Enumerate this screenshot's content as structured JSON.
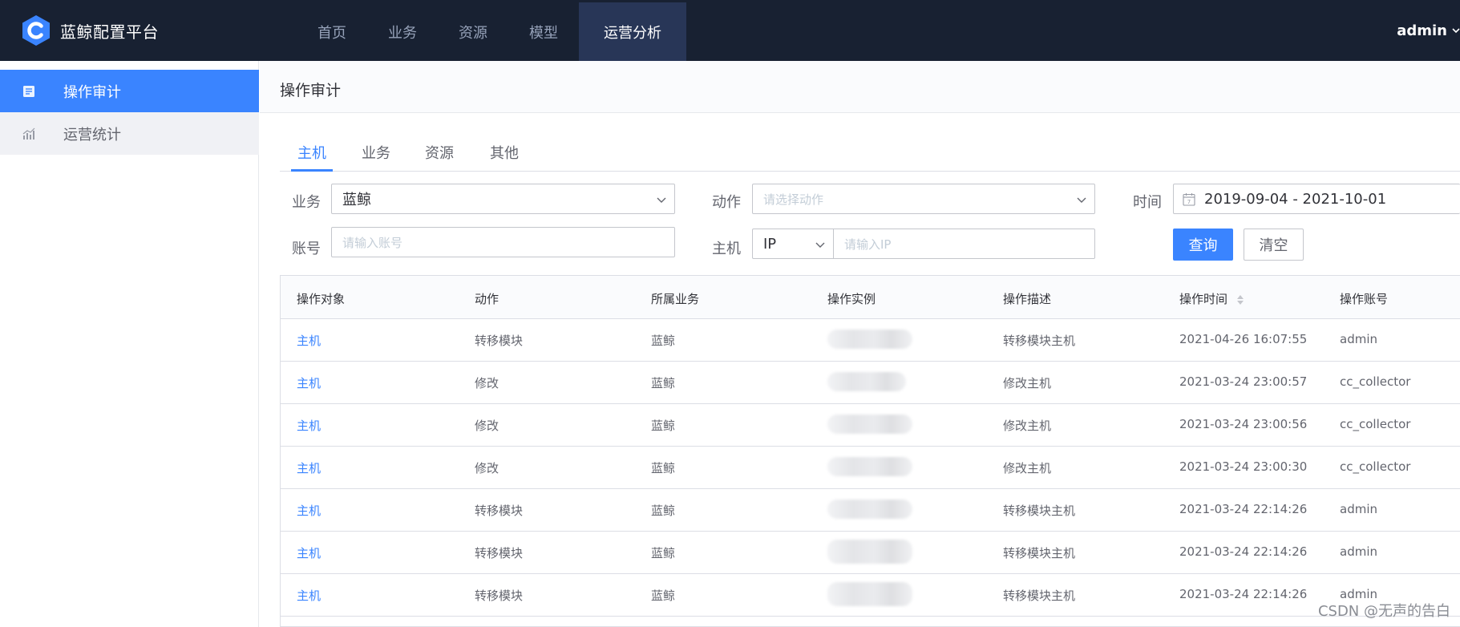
{
  "app": {
    "name": "蓝鲸配置平台"
  },
  "topnav": {
    "items": [
      {
        "label": "首页"
      },
      {
        "label": "业务"
      },
      {
        "label": "资源"
      },
      {
        "label": "模型"
      },
      {
        "label": "运营分析"
      }
    ],
    "active": "运营分析"
  },
  "user": {
    "name": "admin"
  },
  "sidebar": {
    "items": [
      {
        "label": "操作审计",
        "icon": "audit-icon",
        "active": true
      },
      {
        "label": "运营统计",
        "icon": "chart-icon",
        "active": false
      }
    ]
  },
  "page": {
    "title": "操作审计"
  },
  "tabs": [
    {
      "label": "主机"
    },
    {
      "label": "业务"
    },
    {
      "label": "资源"
    },
    {
      "label": "其他"
    }
  ],
  "filters": {
    "business_label": "业务",
    "business_value": "蓝鲸",
    "action_label": "动作",
    "action_placeholder": "请选择动作",
    "time_label": "时间",
    "time_value": "2019-09-04 - 2021-10-01",
    "account_label": "账号",
    "account_placeholder": "请输入账号",
    "host_label": "主机",
    "host_type": "IP",
    "host_placeholder": "请输入IP",
    "query_button": "查询",
    "clear_button": "清空"
  },
  "table": {
    "columns": [
      "操作对象",
      "动作",
      "所属业务",
      "操作实例",
      "操作描述",
      "操作时间",
      "操作账号"
    ],
    "rows": [
      {
        "object": "主机",
        "action": "转移模块",
        "business": "蓝鲸",
        "instance": "",
        "description": "转移模块主机",
        "time": "2021-04-26 16:07:55",
        "account": "admin"
      },
      {
        "object": "主机",
        "action": "修改",
        "business": "蓝鲸",
        "instance": "",
        "description": "修改主机",
        "time": "2021-03-24 23:00:57",
        "account": "cc_collector"
      },
      {
        "object": "主机",
        "action": "修改",
        "business": "蓝鲸",
        "instance": "",
        "description": "修改主机",
        "time": "2021-03-24 23:00:56",
        "account": "cc_collector"
      },
      {
        "object": "主机",
        "action": "修改",
        "business": "蓝鲸",
        "instance": "",
        "description": "修改主机",
        "time": "2021-03-24 23:00:30",
        "account": "cc_collector"
      },
      {
        "object": "主机",
        "action": "转移模块",
        "business": "蓝鲸",
        "instance": "",
        "description": "转移模块主机",
        "time": "2021-03-24 22:14:26",
        "account": "admin"
      },
      {
        "object": "主机",
        "action": "转移模块",
        "business": "蓝鲸",
        "instance": "",
        "description": "转移模块主机",
        "time": "2021-03-24 22:14:26",
        "account": "admin"
      },
      {
        "object": "主机",
        "action": "转移模块",
        "business": "蓝鲸",
        "instance": "",
        "description": "转移模块主机",
        "time": "2021-03-24 22:14:26",
        "account": "admin"
      }
    ]
  },
  "watermark": "CSDN @无声的告白",
  "colors": {
    "topbar": "#182132",
    "accent": "#3a84ff",
    "nav_active": "#283657"
  }
}
